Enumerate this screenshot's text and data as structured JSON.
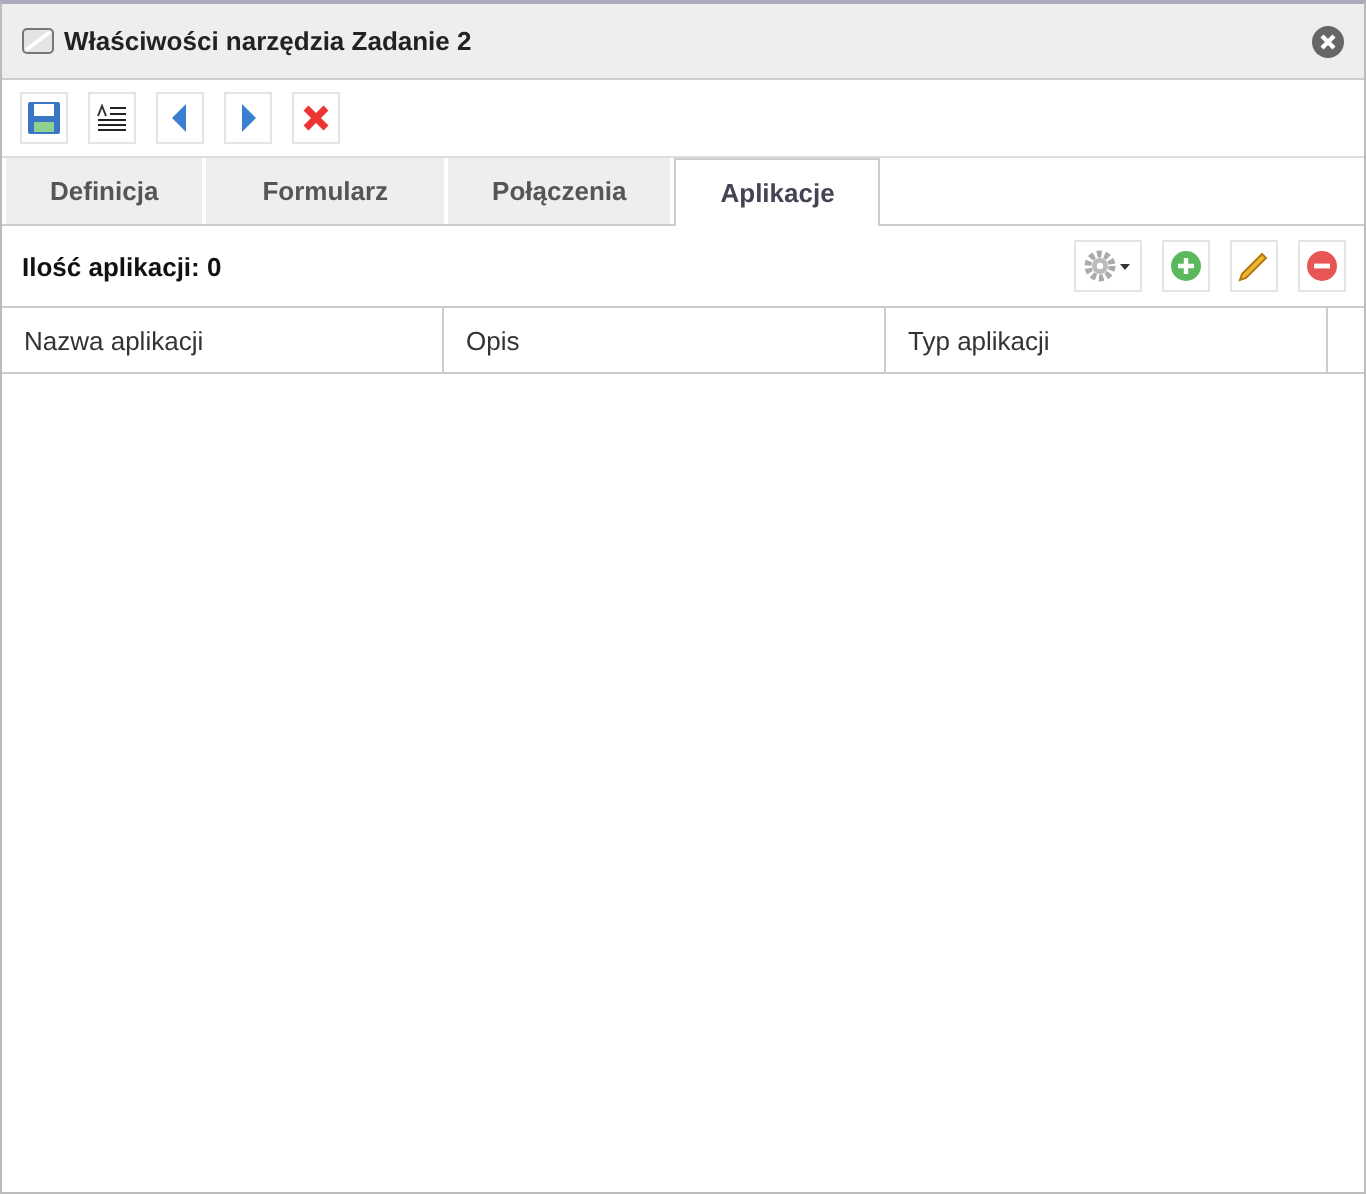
{
  "window": {
    "title": "Właściwości narzędzia Zadanie 2"
  },
  "tabs": [
    {
      "label": "Definicja",
      "selected": false
    },
    {
      "label": "Formularz",
      "selected": false
    },
    {
      "label": "Połączenia",
      "selected": false
    },
    {
      "label": "Aplikacje",
      "selected": true
    }
  ],
  "count_label": "Ilość aplikacji: 0",
  "table": {
    "columns": [
      "Nazwa aplikacji",
      "Opis",
      "Typ aplikacji"
    ]
  }
}
